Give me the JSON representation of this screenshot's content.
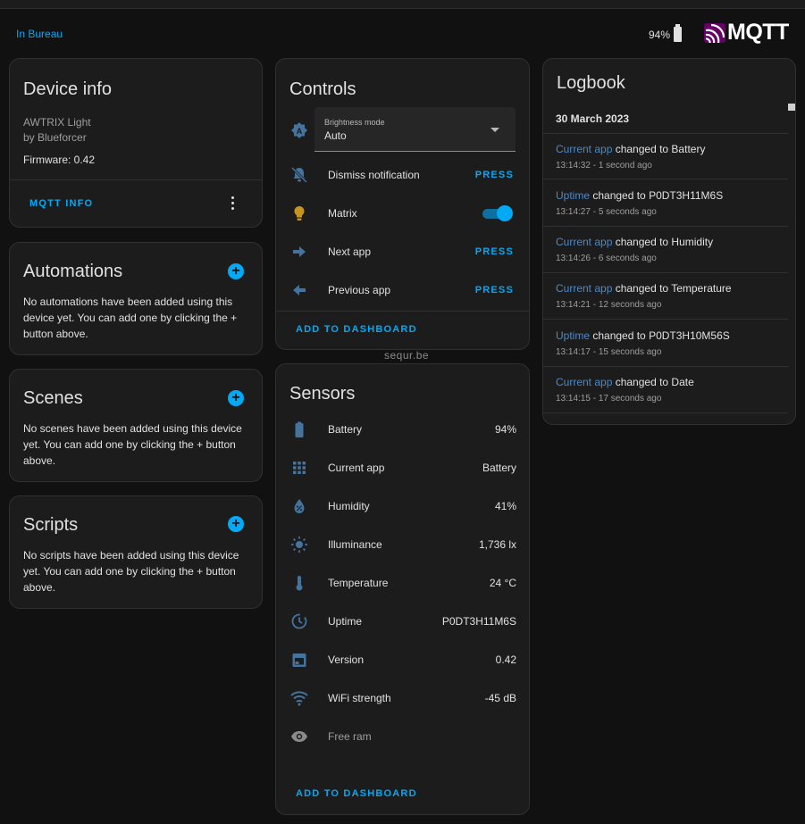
{
  "header": {
    "area_link": "In Bureau",
    "battery_text": "94%",
    "logo_text": "MQTT"
  },
  "device_info": {
    "title": "Device info",
    "model": "AWTRIX Light",
    "manufacturer": "by Blueforcer",
    "firmware": "Firmware: 0.42",
    "mqtt_info_label": "MQTT INFO"
  },
  "automations": {
    "title": "Automations",
    "text": "No automations have been added using this device yet. You can add one by clicking the + button above."
  },
  "scenes": {
    "title": "Scenes",
    "text": "No scenes have been added using this device yet. You can add one by clicking the + button above."
  },
  "scripts": {
    "title": "Scripts",
    "text": "No scripts have been added using this device yet. You can add one by clicking the + button above."
  },
  "controls": {
    "title": "Controls",
    "brightness_mode": {
      "label": "Brightness mode",
      "value": "Auto"
    },
    "dismiss": {
      "label": "Dismiss notification",
      "action": "PRESS"
    },
    "matrix": {
      "label": "Matrix",
      "state": "on"
    },
    "next_app": {
      "label": "Next app",
      "action": "PRESS"
    },
    "previous_app": {
      "label": "Previous app",
      "action": "PRESS"
    },
    "add_to_dashboard": "ADD TO DASHBOARD"
  },
  "watermark": "sequr.be",
  "sensors": {
    "title": "Sensors",
    "items": [
      {
        "label": "Battery",
        "value": "94%",
        "icon": "battery-icon"
      },
      {
        "label": "Current app",
        "value": "Battery",
        "icon": "apps-grid-icon"
      },
      {
        "label": "Humidity",
        "value": "41%",
        "icon": "water-percent-icon"
      },
      {
        "label": "Illuminance",
        "value": "1,736 lx",
        "icon": "brightness-icon"
      },
      {
        "label": "Temperature",
        "value": "24 °C",
        "icon": "thermometer-icon"
      },
      {
        "label": "Uptime",
        "value": "P0DT3H11M6S",
        "icon": "timer-icon"
      },
      {
        "label": "Version",
        "value": "0.42",
        "icon": "calendar-icon"
      },
      {
        "label": "WiFi strength",
        "value": "-45 dB",
        "icon": "wifi-icon"
      },
      {
        "label": "Free ram",
        "value": "",
        "icon": "eye-icon"
      }
    ],
    "add_to_dashboard": "ADD TO DASHBOARD"
  },
  "logbook": {
    "title": "Logbook",
    "date": "30 March 2023",
    "entries": [
      {
        "entity": "Current app",
        "text": " changed to Battery",
        "time": "13:14:32 - 1 second ago"
      },
      {
        "entity": "Uptime",
        "text": " changed to P0DT3H11M6S",
        "time": "13:14:27 - 5 seconds ago"
      },
      {
        "entity": "Current app",
        "text": " changed to Humidity",
        "time": "13:14:26 - 6 seconds ago"
      },
      {
        "entity": "Current app",
        "text": " changed to Temperature",
        "time": "13:14:21 - 12 seconds ago"
      },
      {
        "entity": "Uptime",
        "text": " changed to P0DT3H10M56S",
        "time": "13:14:17 - 15 seconds ago"
      },
      {
        "entity": "Current app",
        "text": " changed to Date",
        "time": "13:14:15 - 17 seconds ago"
      }
    ]
  },
  "colors": {
    "accent": "#03a9f4",
    "icon_blue": "#44739e",
    "bulb_on": "#c7951f",
    "background": "#111111",
    "card": "#1c1c1c"
  }
}
